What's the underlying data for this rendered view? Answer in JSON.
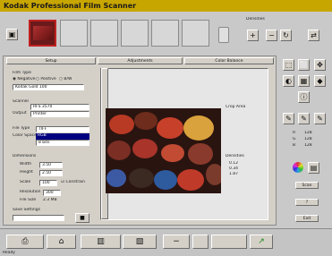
{
  "window": {
    "title": "Kodak Professional Film Scanner"
  },
  "thumbnails": {
    "count": 6,
    "selected": 0
  },
  "toolbar": {
    "left_icon": "scanner-icon",
    "right_label": "Densities",
    "right_icons": [
      "zoom-in-icon",
      "zoom-out-icon",
      "rotate-icon",
      "flip-icon"
    ],
    "eject_icon": "film-holder-icon"
  },
  "tabs": [
    "Setup",
    "Adjustments",
    "Color Balance"
  ],
  "setup": {
    "film_type_label": "Film Type",
    "film_options": [
      "Negative",
      "Positive",
      "B/W"
    ],
    "film_select": "Kodak Gold 100",
    "scanner_label": "Scanner",
    "scanner_value": "RFS 3570",
    "output_label": "Output",
    "output_value": "Printer",
    "file_type_label": "File Type",
    "file_type_value": "TIFF",
    "color_space_label": "Color Space",
    "color_space_value": "RGB",
    "bits_label": "8 bits",
    "dimensions_label": "Dimensions",
    "width_label": "Width",
    "width_value": "3.50",
    "height_label": "Height",
    "height_value": "2.50",
    "scale_label": "Scale",
    "scale_value": "100",
    "constrain_label": "Constrain",
    "resolution_label": "Resolution",
    "resolution_value": "300",
    "file_size_label": "File Size",
    "file_size_value": "2.3 MB",
    "save_label": "Save Settings"
  },
  "preview": {
    "side_label_top": "Crop Area",
    "side_label_bottom": "Densities",
    "density_values": [
      "0.12",
      "0.34",
      "1.87"
    ]
  },
  "right_panel": {
    "rgb_labels": [
      "R",
      "G",
      "B"
    ],
    "rgb_values": [
      "128",
      "128",
      "128"
    ],
    "btn_scan": "Scan",
    "btn_help": "?",
    "btn_exit": "Exit"
  },
  "bottom_bar": {
    "buttons": [
      "scanner-icon",
      "preview-icon",
      "crop-icon",
      "batch-icon",
      "minus-icon",
      "blank",
      "blank",
      "go-icon"
    ],
    "status": "Ready"
  },
  "colors": {
    "title_bg": "#c8a600",
    "highlight": "#000080",
    "selection": "#c02020"
  }
}
